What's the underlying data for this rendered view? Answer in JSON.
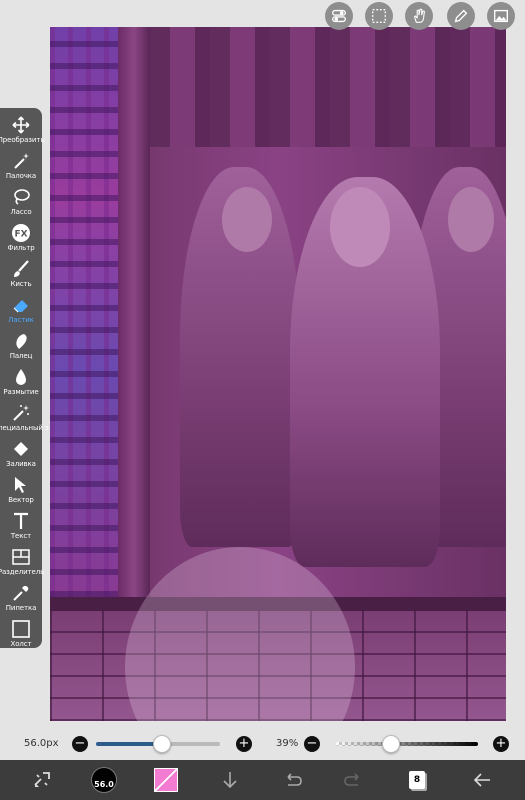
{
  "toolbar": {
    "tools": [
      {
        "label": "Преобразить",
        "icon": "move-icon"
      },
      {
        "label": "Палочка",
        "icon": "magic-wand-icon"
      },
      {
        "label": "Лассо",
        "icon": "lasso-icon"
      },
      {
        "label": "Фильтр",
        "icon": "fx-icon"
      },
      {
        "label": "Кисть",
        "icon": "brush-icon"
      },
      {
        "label": "Ластик",
        "icon": "eraser-icon",
        "active": true
      },
      {
        "label": "Палец",
        "icon": "smudge-icon"
      },
      {
        "label": "Размытие",
        "icon": "blur-icon"
      },
      {
        "label": "Специальный э",
        "icon": "special-effect-icon"
      },
      {
        "label": "Заливка",
        "icon": "fill-icon"
      },
      {
        "label": "Вектор",
        "icon": "vector-icon"
      },
      {
        "label": "Текст",
        "icon": "text-icon"
      },
      {
        "label": "Разделитель",
        "icon": "frame-divider-icon"
      },
      {
        "label": "Пипетка",
        "icon": "eyedropper-icon"
      },
      {
        "label": "Холст",
        "icon": "canvas-icon"
      }
    ]
  },
  "top_buttons": [
    "toggle-icon",
    "selection-icon",
    "hand-icon",
    "pen-icon",
    "image-icon"
  ],
  "sliders": {
    "size_value": "56.0px",
    "size_fraction": 0.53,
    "opacity_value": "39%",
    "opacity_fraction": 0.39,
    "minus": "−",
    "plus": "+"
  },
  "bottom_bar": {
    "brush_size_label": "56.0",
    "color": "#f37bd2",
    "layer_count": "8"
  },
  "colors": {
    "toolbar_bg": "#575757",
    "accent": "#4aa8ff",
    "slider_fill": "#2d5b8c"
  }
}
